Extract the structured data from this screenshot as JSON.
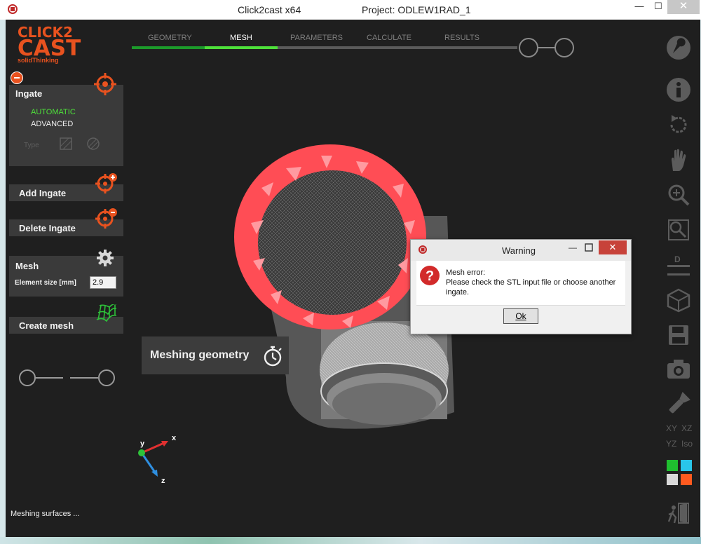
{
  "window": {
    "title": "Click2cast x64",
    "project": "Project: ODLEW1RAD_1",
    "minimize": "—",
    "maximize": "☐",
    "close": "✕"
  },
  "logo": {
    "line1": "CLICK2",
    "line2": "CAST",
    "line3": "solidThinking"
  },
  "tabs": [
    {
      "label": "GEOMETRY",
      "state": "done"
    },
    {
      "label": "MESH",
      "state": "active"
    },
    {
      "label": "PARAMETERS",
      "state": "pending"
    },
    {
      "label": "CALCULATE",
      "state": "pending"
    },
    {
      "label": "RESULTS",
      "state": "pending"
    }
  ],
  "sidebar": {
    "ingate": {
      "title": "Ingate",
      "option_automatic": "AUTOMATIC",
      "option_advanced": "ADVANCED",
      "type_label": "Type"
    },
    "add_ingate": "Add Ingate",
    "delete_ingate": "Delete Ingate",
    "mesh": {
      "title": "Mesh",
      "element_size_label": "Element size [mm]",
      "element_size_value": "2.9"
    },
    "create_mesh": "Create mesh"
  },
  "status": {
    "message": "Meshing surfaces ...",
    "overlay": "Meshing geometry"
  },
  "axes": {
    "x": "x",
    "y": "y",
    "z": "z"
  },
  "toolbar": {
    "tools": [
      "wrench-icon",
      "info-icon",
      "rotate-icon",
      "pan-hand-icon",
      "zoom-icon",
      "zoom-window-icon",
      "dimension-icon",
      "cube-view-icon",
      "save-icon",
      "camera-icon",
      "flashlight-icon"
    ],
    "view_xy": "XY",
    "view_xz": "XZ",
    "view_yz": "YZ",
    "view_iso": "Iso",
    "colors": [
      "#1fbf2f",
      "#29c6ea",
      "#d9d9d9",
      "#ff5a1f"
    ]
  },
  "dialog": {
    "title": "Warning",
    "message_line1": "Mesh error:",
    "message_line2": "Please check the STL input file or choose another ingate.",
    "ok": "Ok"
  },
  "colors": {
    "accent": "#e8521f",
    "progress_done": "#1c9a2a",
    "progress_active": "#4ee03a",
    "ring": "#ff4d55",
    "background": "#1f1f1f"
  }
}
